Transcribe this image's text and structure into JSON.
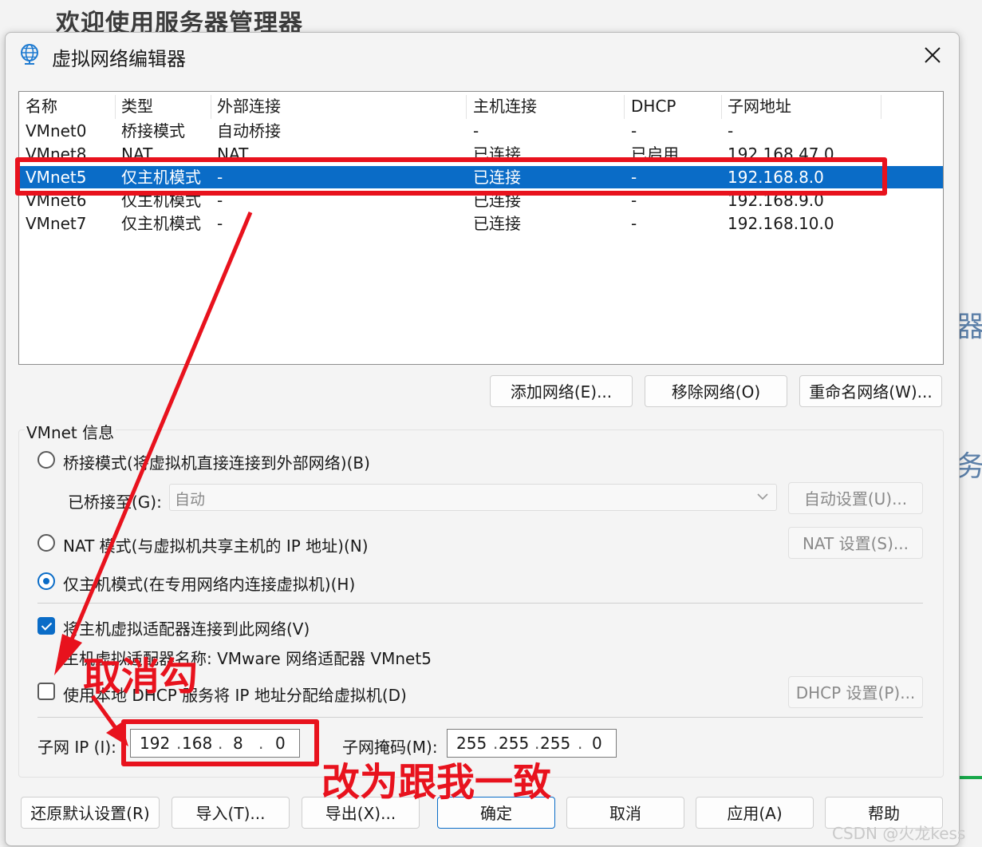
{
  "background": {
    "title": "欢迎使用服务器管理器",
    "edge_glyph_1": "器",
    "edge_glyph_2": "务"
  },
  "dialog": {
    "title": "虚拟网络编辑器",
    "icon": "globe-network-icon",
    "close_icon": "close-icon"
  },
  "network_list": {
    "columns": [
      "名称",
      "类型",
      "外部连接",
      "主机连接",
      "DHCP",
      "子网地址"
    ],
    "rows": [
      {
        "name": "VMnet0",
        "type": "桥接模式",
        "external": "自动桥接",
        "host": "-",
        "dhcp": "-",
        "subnet": "-"
      },
      {
        "name": "VMnet8",
        "type": "NAT",
        "external": "NAT",
        "host": "已连接",
        "dhcp": "已启用",
        "subnet": "192.168.47.0"
      },
      {
        "name": "VMnet5",
        "type": "仅主机模式",
        "external": "-",
        "host": "已连接",
        "dhcp": "-",
        "subnet": "192.168.8.0"
      },
      {
        "name": "VMnet6",
        "type": "仅主机模式",
        "external": "-",
        "host": "已连接",
        "dhcp": "-",
        "subnet": "192.168.9.0"
      },
      {
        "name": "VMnet7",
        "type": "仅主机模式",
        "external": "-",
        "host": "已连接",
        "dhcp": "-",
        "subnet": "192.168.10.0"
      }
    ],
    "selected_row": "VMnet5"
  },
  "list_buttons": {
    "add": "添加网络(E)...",
    "remove": "移除网络(O)",
    "rename": "重命名网络(W)..."
  },
  "vmnet_info": {
    "label": "VMnet 信息",
    "bridged_radio": "桥接模式(将虚拟机直接连接到外部网络)(B)",
    "bridged_to_label": "已桥接至(G):",
    "bridged_to_value": "自动",
    "auto_settings_button": "自动设置(U)...",
    "nat_radio": "NAT 模式(与虚拟机共享主机的 IP 地址)(N)",
    "nat_settings_button": "NAT 设置(S)...",
    "hostonly_radio": "仅主机模式(在专用网络内连接虚拟机)(H)",
    "selected_mode": "hostonly",
    "connect_adapter_check": "将主机虚拟适配器连接到此网络(V)",
    "connect_adapter_checked": true,
    "adapter_name_label": "主机虚拟适配器名称: VMware 网络适配器 VMnet5",
    "dhcp_check": "使用本地 DHCP 服务将 IP 地址分配给虚拟机(D)",
    "dhcp_checked": false,
    "dhcp_settings_button": "DHCP 设置(P)...",
    "subnet_ip_label": "子网 IP (I):",
    "subnet_ip": [
      "192",
      "168",
      "8",
      "0"
    ],
    "subnet_mask_label": "子网掩码(M):",
    "subnet_mask": [
      "255",
      "255",
      "255",
      "0"
    ]
  },
  "footer_buttons": {
    "restore": "还原默认设置(R)",
    "import": "导入(T)...",
    "export": "导出(X)...",
    "ok": "确定",
    "cancel": "取消",
    "apply": "应用(A)",
    "help": "帮助"
  },
  "annotations": {
    "uncheck_note": "取消勾",
    "match_note": "改为跟我一致",
    "color": "#e8121d"
  },
  "watermark": "CSDN @火龙kess"
}
